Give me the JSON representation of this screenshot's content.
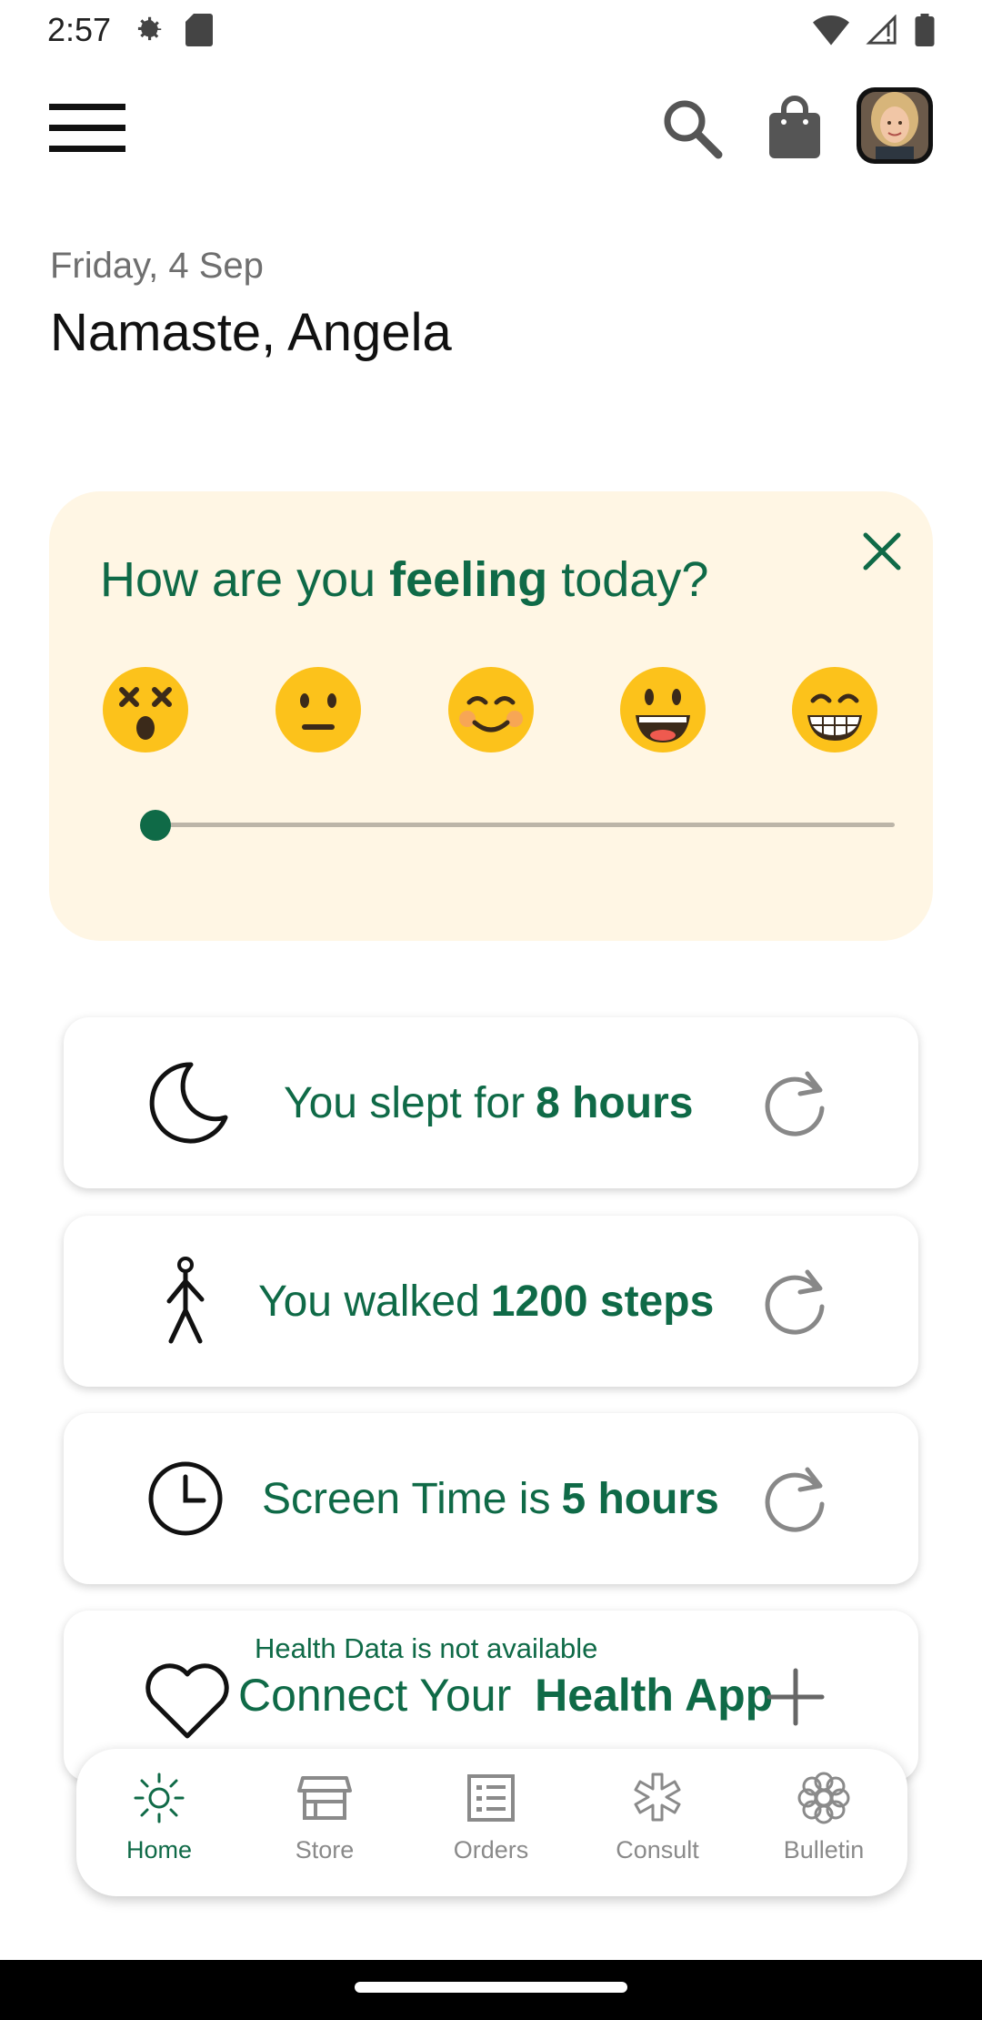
{
  "status_bar": {
    "time": "2:57",
    "icons": [
      "settings-gear-icon",
      "sd-card-icon",
      "wifi-icon",
      "signal-icon",
      "battery-icon"
    ]
  },
  "app_bar": {
    "icons": [
      "menu-icon",
      "search-icon",
      "shopping-bag-icon",
      "avatar"
    ]
  },
  "header": {
    "date": "Friday, 4 Sep",
    "greeting": "Namaste, Angela"
  },
  "mood": {
    "question_prefix": "How are you",
    "question_bold": "feeling",
    "question_suffix": "today?",
    "emojis": [
      "dizzy-face-emoji",
      "neutral-face-emoji",
      "smiling-face-emoji",
      "grinning-face-emoji",
      "beaming-face-emoji"
    ],
    "slider_value": 0
  },
  "stats": {
    "sleep": {
      "prefix": "You slept for",
      "value": "8 hours"
    },
    "walk": {
      "prefix": "You walked",
      "value": "1200 steps"
    },
    "screen": {
      "prefix": "Screen Time is",
      "value": "5 hours"
    },
    "health": {
      "note": "Health Data is not available",
      "prefix": "Connect Your",
      "value": "Health App"
    }
  },
  "nav": {
    "items": [
      {
        "label": "Home",
        "icon": "sun-icon",
        "active": true
      },
      {
        "label": "Store",
        "icon": "store-icon",
        "active": false
      },
      {
        "label": "Orders",
        "icon": "list-icon",
        "active": false
      },
      {
        "label": "Consult",
        "icon": "asterisk-icon",
        "active": false
      },
      {
        "label": "Bulletin",
        "icon": "flower-icon",
        "active": false
      }
    ]
  },
  "colors": {
    "accent": "#0f6a47",
    "mood_card_bg": "#fff6e4",
    "inactive": "#8a8a8a"
  }
}
